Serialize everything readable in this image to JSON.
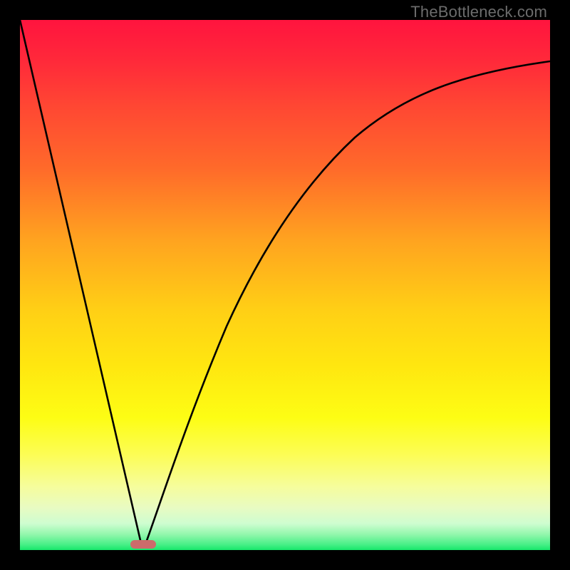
{
  "watermark": "TheBottleneck.com",
  "chart_data": {
    "type": "line",
    "title": "",
    "xlabel": "",
    "ylabel": "",
    "xlim": [
      0,
      100
    ],
    "ylim": [
      0,
      100
    ],
    "x": [
      0,
      5,
      10,
      15,
      20,
      23,
      25,
      28,
      30,
      35,
      40,
      45,
      50,
      55,
      60,
      65,
      70,
      75,
      80,
      85,
      90,
      95,
      100
    ],
    "values": [
      100,
      77,
      54,
      31,
      8,
      0,
      8,
      19,
      28,
      45,
      57,
      66,
      72,
      77,
      80,
      83,
      85,
      86.5,
      88,
      89,
      90,
      90.7,
      91.3
    ],
    "minimum_x": 23,
    "gradient_colors": {
      "top": "#ff143e",
      "bottom": "#16e76a"
    },
    "marker": {
      "x_range": [
        22,
        26
      ],
      "y": 0,
      "color": "#cc6b6b"
    }
  }
}
